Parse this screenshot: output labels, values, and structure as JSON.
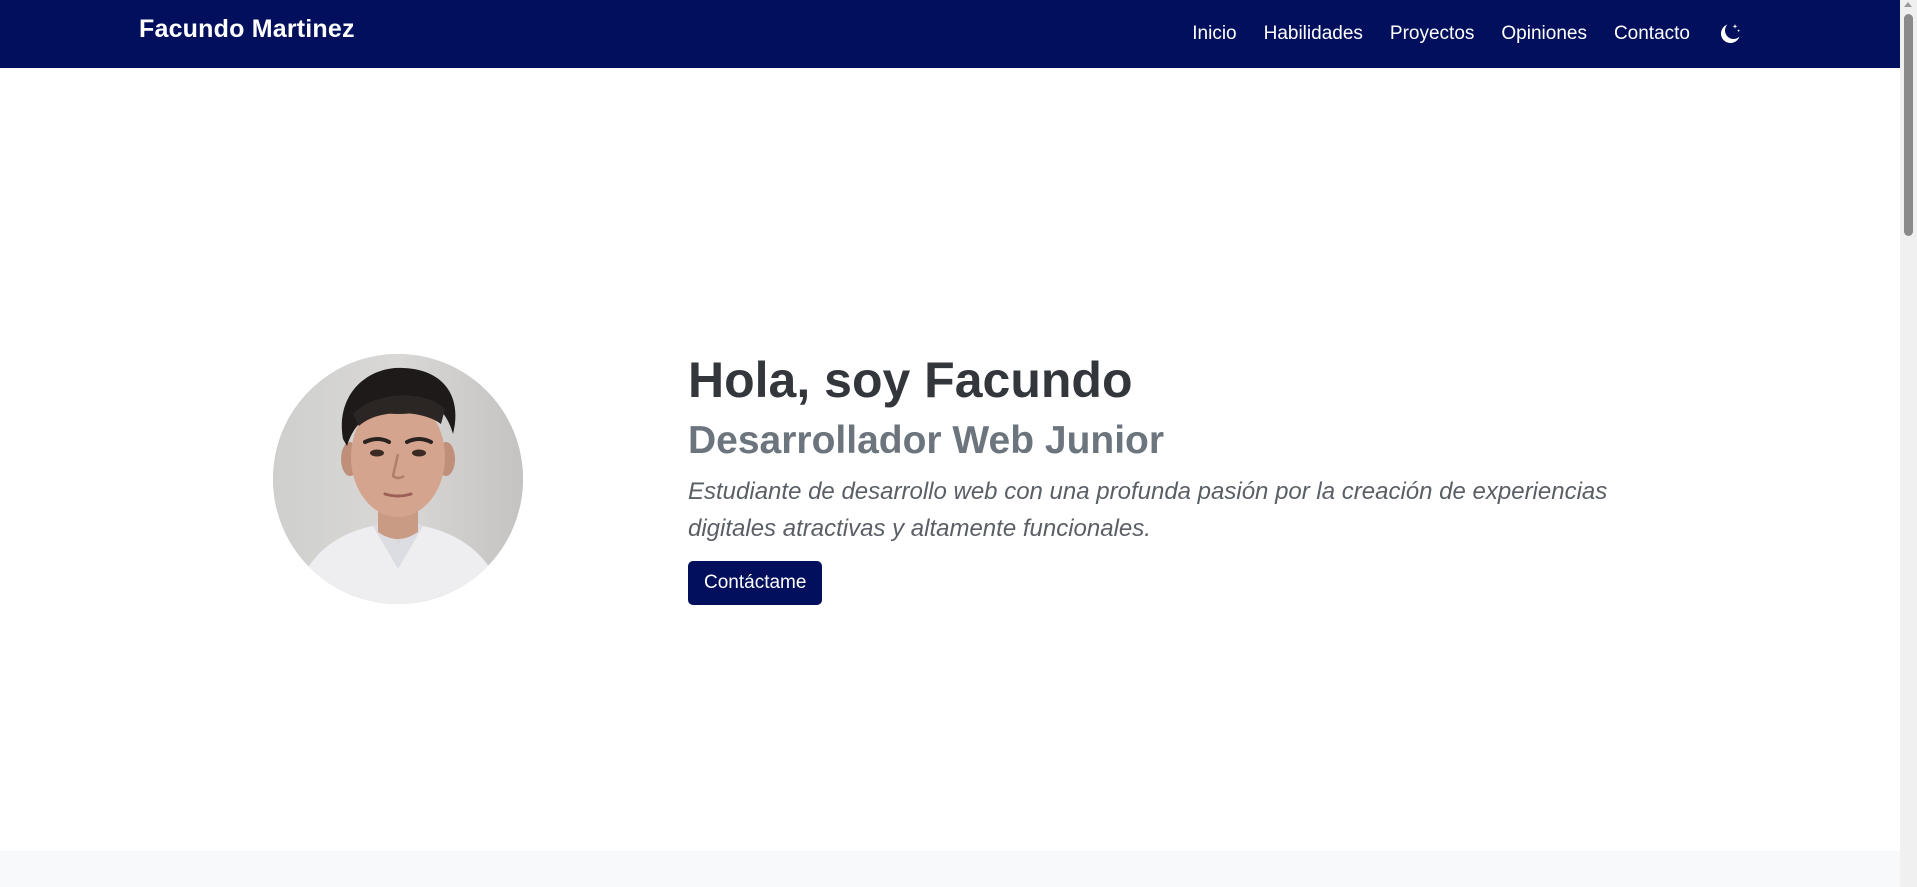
{
  "navbar": {
    "brand": "Facundo Martinez",
    "links": [
      {
        "label": "Inicio"
      },
      {
        "label": "Habilidades"
      },
      {
        "label": "Proyectos"
      },
      {
        "label": "Opiniones"
      },
      {
        "label": "Contacto"
      }
    ],
    "theme_toggle_icon": "moon-stars-icon",
    "background_color": "#020f5c"
  },
  "hero": {
    "title": "Hola, soy Facundo",
    "subtitle": "Desarrollador Web Junior",
    "description": "Estudiante de desarrollo web con una profunda pasión por la creación de experiencias digitales atractivas y altamente funcionales.",
    "cta_label": "Contáctame",
    "avatar_icon": "profile-photo"
  },
  "colors": {
    "accent": "#020f5c",
    "title": "#33363a",
    "subtitle": "#6c757d"
  }
}
